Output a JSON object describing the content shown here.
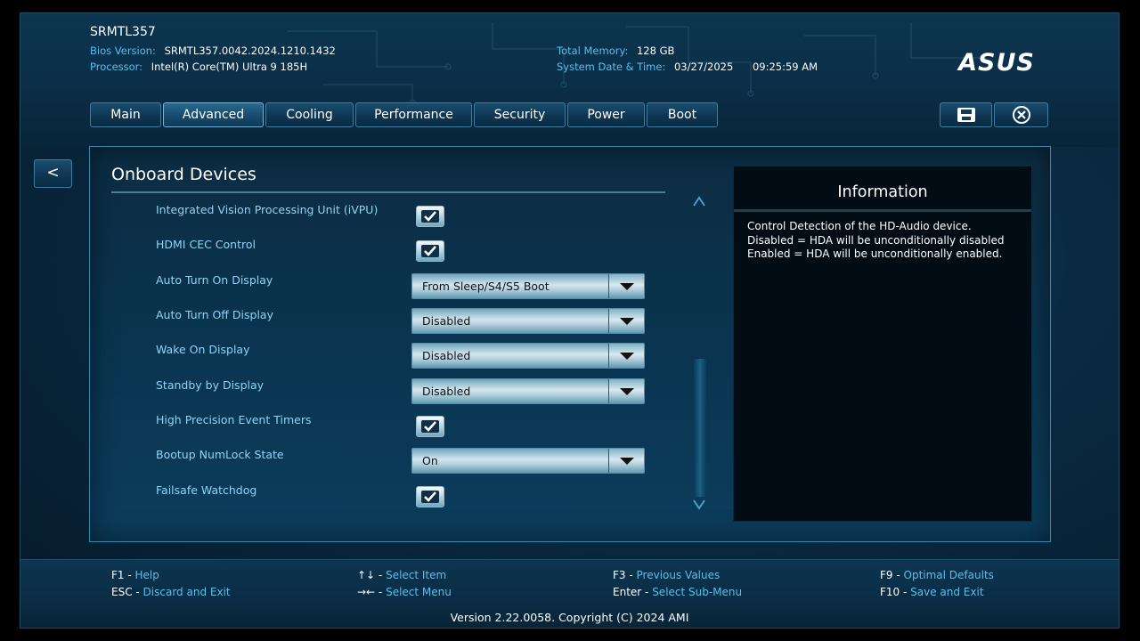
{
  "header": {
    "system_name": "SRMTL357",
    "bios_version_label": "Bios Version:",
    "bios_version": "SRMTL357.0042.2024.1210.1432",
    "processor_label": "Processor:",
    "processor": "Intel(R) Core(TM) Ultra 9 185H",
    "memory_label": "Total Memory:",
    "memory": "128 GB",
    "datetime_label": "System Date & Time:",
    "date": "03/27/2025",
    "time": "09:25:59 AM",
    "logo_text": "ASUS"
  },
  "tabs": [
    {
      "label": "Main"
    },
    {
      "label": "Advanced",
      "active": true
    },
    {
      "label": "Cooling"
    },
    {
      "label": "Performance"
    },
    {
      "label": "Security"
    },
    {
      "label": "Power"
    },
    {
      "label": "Boot"
    }
  ],
  "icons": {
    "save": "save-icon",
    "exit": "close-circle-icon",
    "check": "checkmark-icon",
    "dropdown": "chevron-down-icon",
    "scroll_up": "chevron-up-icon",
    "scroll_down": "chevron-down-icon"
  },
  "back_label": "<",
  "section": {
    "title": "Onboard Devices",
    "rows": [
      {
        "label": "Integrated Vision Processing Unit (iVPU)",
        "type": "checkbox",
        "checked": true
      },
      {
        "label": "HDMI CEC Control",
        "type": "checkbox",
        "checked": true
      },
      {
        "label": "Auto Turn On Display",
        "type": "select",
        "value": "From Sleep/S4/S5 Boot"
      },
      {
        "label": "Auto Turn Off Display",
        "type": "select",
        "value": "Disabled"
      },
      {
        "label": "Wake On Display",
        "type": "select",
        "value": "Disabled"
      },
      {
        "label": "Standby by Display",
        "type": "select",
        "value": "Disabled"
      },
      {
        "label": "High Precision Event Timers",
        "type": "checkbox",
        "checked": true
      },
      {
        "label": "Bootup NumLock State",
        "type": "select",
        "value": "On"
      },
      {
        "label": "Failsafe Watchdog",
        "type": "checkbox",
        "checked": true
      }
    ]
  },
  "information": {
    "title": "Information",
    "lines": [
      "Control Detection of the HD-Audio device.",
      "Disabled = HDA will be unconditionally disabled",
      "Enabled = HDA will be unconditionally enabled."
    ]
  },
  "footer": {
    "hotkeys": [
      {
        "key": "F1",
        "desc": "Help"
      },
      {
        "key": "ESC",
        "desc": "Discard and Exit"
      },
      {
        "key": "↑↓",
        "desc": "Select Item"
      },
      {
        "key": "→←",
        "desc": "Select Menu"
      },
      {
        "key": "F3",
        "desc": "Previous Values"
      },
      {
        "key": "Enter",
        "desc": "Select Sub-Menu"
      },
      {
        "key": "F9",
        "desc": "Optimal Defaults"
      },
      {
        "key": "F10",
        "desc": "Save and Exit"
      }
    ],
    "version": "Version 2.22.0058. Copyright (C) 2024 AMI"
  },
  "colors": {
    "accent": "#56c0ee",
    "label": "#8fd4f4",
    "panel_border": "#3b87ad"
  }
}
